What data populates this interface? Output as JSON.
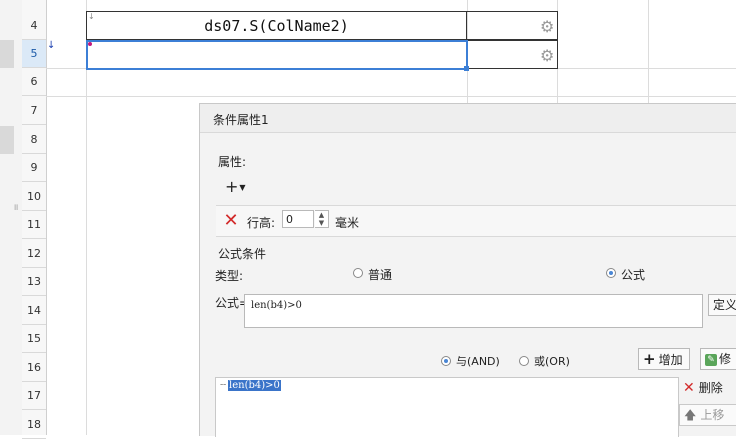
{
  "sheet": {
    "row_numbers": [
      "4",
      "5",
      "6",
      "7",
      "8",
      "9",
      "10",
      "11",
      "12",
      "13",
      "14",
      "15",
      "16",
      "17",
      "18"
    ],
    "selected_row": "5",
    "cell_c4_text": "ds07.S(ColName2)"
  },
  "dialog": {
    "title": "条件属性1",
    "properties_label": "属性:",
    "row_height_label": "行高:",
    "row_height_value": "0",
    "row_height_unit": "毫米",
    "formula_condition_label": "公式条件",
    "type_label": "类型:",
    "type_options": [
      "普通",
      "公式"
    ],
    "type_selected": "公式",
    "formula_label": "公式=",
    "formula_value": "len(b4)>0",
    "define_button": "定义",
    "logic_and": "与(AND)",
    "logic_or": "或(OR)",
    "logic_selected": "与(AND)",
    "add_button": "增加",
    "modify_button": "修",
    "conditions": [
      "len(b4)>0"
    ],
    "delete_button": "删除",
    "move_up_button": "上移"
  },
  "colors": {
    "selection_blue": "#3c7fd6",
    "delete_red": "#d22a2a",
    "highlight_blue": "#3a74c9"
  }
}
